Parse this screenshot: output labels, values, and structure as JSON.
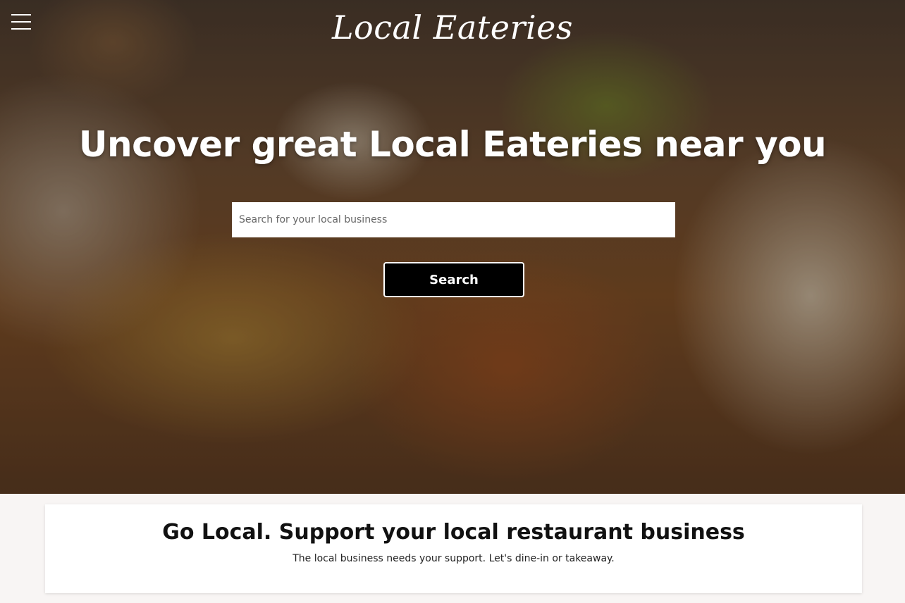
{
  "header": {
    "brand": "Local Eateries",
    "menu_icon": "hamburger-menu-icon"
  },
  "hero": {
    "headline": "Uncover great Local Eateries near you",
    "search": {
      "placeholder": "Search for your local business",
      "value": ""
    },
    "search_button_label": "Search",
    "background_description_colors": [
      "#6b4b30",
      "#7a4c25"
    ]
  },
  "promo": {
    "title": "Go Local. Support your local restaurant business",
    "text": "The local business needs your support. Let's dine-in or takeaway."
  },
  "colors": {
    "button_bg": "#000000",
    "button_text": "#ffffff",
    "page_bg": "#f8f5f4"
  }
}
